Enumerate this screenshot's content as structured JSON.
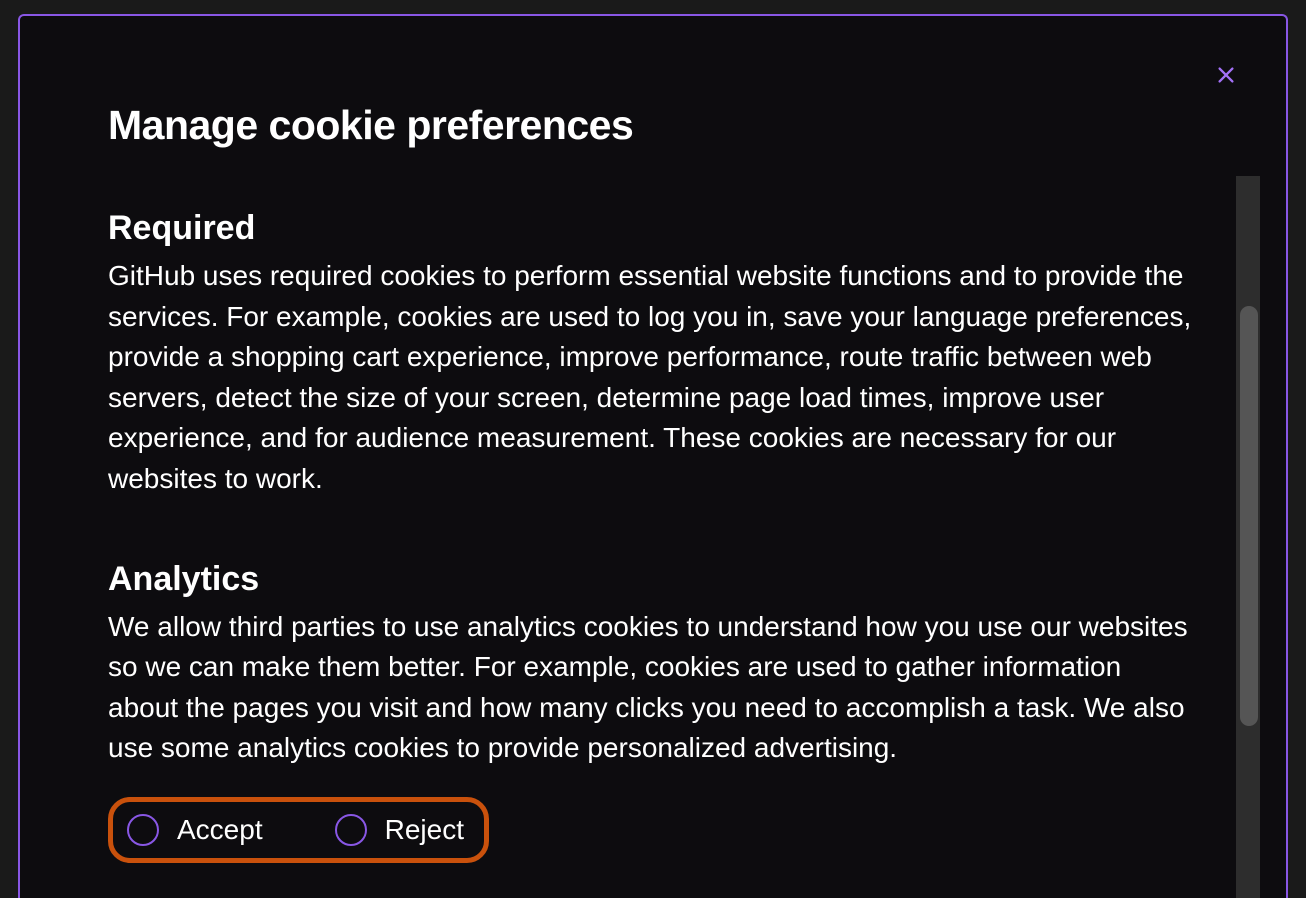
{
  "modal": {
    "title": "Manage cookie preferences",
    "sections": [
      {
        "heading": "Required",
        "body": "GitHub uses required cookies to perform essential website functions and to provide the services. For example, cookies are used to log you in, save your language preferences, provide a shopping cart experience, improve performance, route traffic between web servers, detect the size of your screen, determine page load times, improve user experience, and for audience measurement. These cookies are necessary for our websites to work."
      },
      {
        "heading": "Analytics",
        "body": "We allow third parties to use analytics cookies to understand how you use our websites so we can make them better. For example, cookies are used to gather information about the pages you visit and how many clicks you need to accomplish a task. We also use some analytics cookies to provide personalized advertising."
      }
    ],
    "radio": {
      "accept_label": "Accept",
      "reject_label": "Reject"
    }
  }
}
